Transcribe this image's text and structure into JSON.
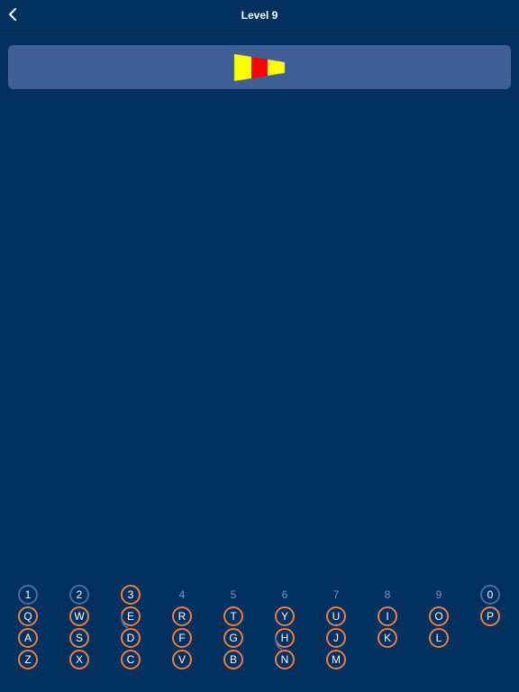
{
  "header": {
    "title": "Level 9",
    "back_icon": "chevron-left-icon"
  },
  "flag": {
    "icon": "pennant-flag-icon",
    "stripes": [
      "#ffff00",
      "#ff0000",
      "#ffff00"
    ]
  },
  "colors": {
    "background": "#02315f",
    "card": "#3d5f94",
    "key_ring_active": "#e97e45",
    "key_ring_used": "#4d6b99",
    "key_disabled_text": "#7d93b5"
  },
  "keyboard": {
    "row1": [
      {
        "label": "1",
        "state": "used"
      },
      {
        "label": "2",
        "state": "used"
      },
      {
        "label": "3",
        "state": "active"
      },
      {
        "label": "4",
        "state": "disabled"
      },
      {
        "label": "5",
        "state": "disabled"
      },
      {
        "label": "6",
        "state": "disabled"
      },
      {
        "label": "7",
        "state": "disabled"
      },
      {
        "label": "8",
        "state": "disabled"
      },
      {
        "label": "9",
        "state": "disabled"
      },
      {
        "label": "0",
        "state": "used"
      }
    ],
    "row2": [
      {
        "label": "Q",
        "state": "active"
      },
      {
        "label": "W",
        "state": "active"
      },
      {
        "label": "E",
        "state": "active"
      },
      {
        "label": "R",
        "state": "active"
      },
      {
        "label": "T",
        "state": "active"
      },
      {
        "label": "Y",
        "state": "active"
      },
      {
        "label": "U",
        "state": "active"
      },
      {
        "label": "I",
        "state": "active"
      },
      {
        "label": "O",
        "state": "active"
      },
      {
        "label": "P",
        "state": "active"
      }
    ],
    "row3": [
      {
        "label": "A",
        "state": "active"
      },
      {
        "label": "S",
        "state": "active"
      },
      {
        "label": "D",
        "state": "active"
      },
      {
        "label": "F",
        "state": "active"
      },
      {
        "label": "G",
        "state": "active"
      },
      {
        "label": "H",
        "state": "active"
      },
      {
        "label": "J",
        "state": "active"
      },
      {
        "label": "K",
        "state": "active"
      },
      {
        "label": "L",
        "state": "active"
      }
    ],
    "row4": [
      {
        "label": "Z",
        "state": "active"
      },
      {
        "label": "X",
        "state": "active"
      },
      {
        "label": "C",
        "state": "active"
      },
      {
        "label": "V",
        "state": "active"
      },
      {
        "label": "B",
        "state": "active"
      },
      {
        "label": "N",
        "state": "active"
      },
      {
        "label": "M",
        "state": "active"
      }
    ]
  }
}
